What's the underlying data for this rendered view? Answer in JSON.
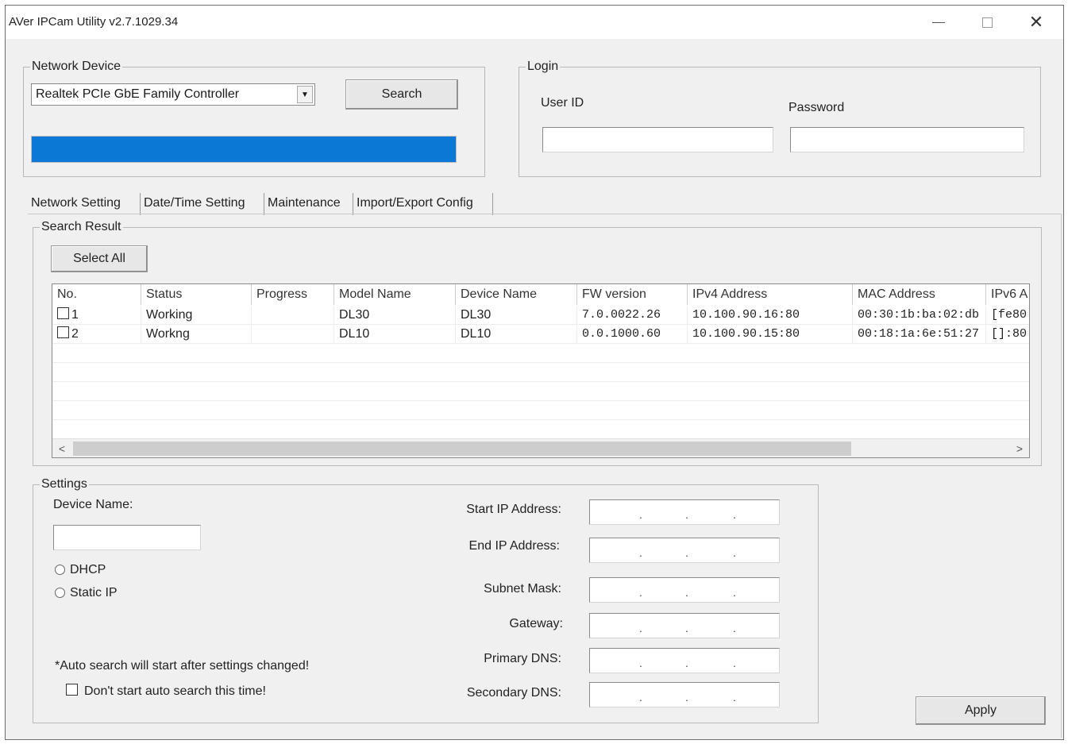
{
  "window": {
    "title": "AVer IPCam Utility v2.7.1029.34"
  },
  "network_device": {
    "legend": "Network Device",
    "selected_adapter": "Realtek PCIe GbE Family Controller",
    "search_label": "Search",
    "progress": 1.0,
    "progress_color": "#0a78d4"
  },
  "login": {
    "legend": "Login",
    "user_id_label": "User ID",
    "password_label": "Password",
    "user_id_value": "",
    "password_value": ""
  },
  "tabs": [
    {
      "label": "Network Setting",
      "active": true
    },
    {
      "label": "Date/Time Setting",
      "active": false
    },
    {
      "label": "Maintenance",
      "active": false
    },
    {
      "label": "Import/Export Config",
      "active": false
    }
  ],
  "search_result": {
    "legend": "Search Result",
    "select_all_label": "Select All",
    "columns": [
      "No.",
      "Status",
      "Progress",
      "Model Name",
      "Device Name",
      "FW version",
      "IPv4 Address",
      "MAC Address",
      "IPv6 A"
    ],
    "rows": [
      {
        "no": "1",
        "status": "Working",
        "progress": "",
        "model": "DL30",
        "device": "DL30",
        "fw": "7.0.0022.26",
        "ipv4": "10.100.90.16:80",
        "mac": "00:30:1b:ba:02:db",
        "ipv6": "[fe80:"
      },
      {
        "no": "2",
        "status": "Workng",
        "progress": "",
        "model": "DL10",
        "device": "DL10",
        "fw": "0.0.1000.60",
        "ipv4": "10.100.90.15:80",
        "mac": "00:18:1a:6e:51:27",
        "ipv6": "[]:80"
      }
    ],
    "scroll_left": "<",
    "scroll_right": ">"
  },
  "settings": {
    "legend": "Settings",
    "device_name_label": "Device Name:",
    "device_name_value": "",
    "dhcp_label": "DHCP",
    "static_ip_label": "Static IP",
    "note": "*Auto search will start after settings changed!",
    "dont_search_label": "Don't start auto search this time!",
    "fields": [
      {
        "label": "Start IP Address:"
      },
      {
        "label": "End IP Address:"
      },
      {
        "label": "Subnet Mask:"
      },
      {
        "label": "Gateway:"
      },
      {
        "label": "Primary DNS:"
      },
      {
        "label": "Secondary DNS:"
      }
    ],
    "ip_dot": ".",
    "apply_label": "Apply"
  }
}
